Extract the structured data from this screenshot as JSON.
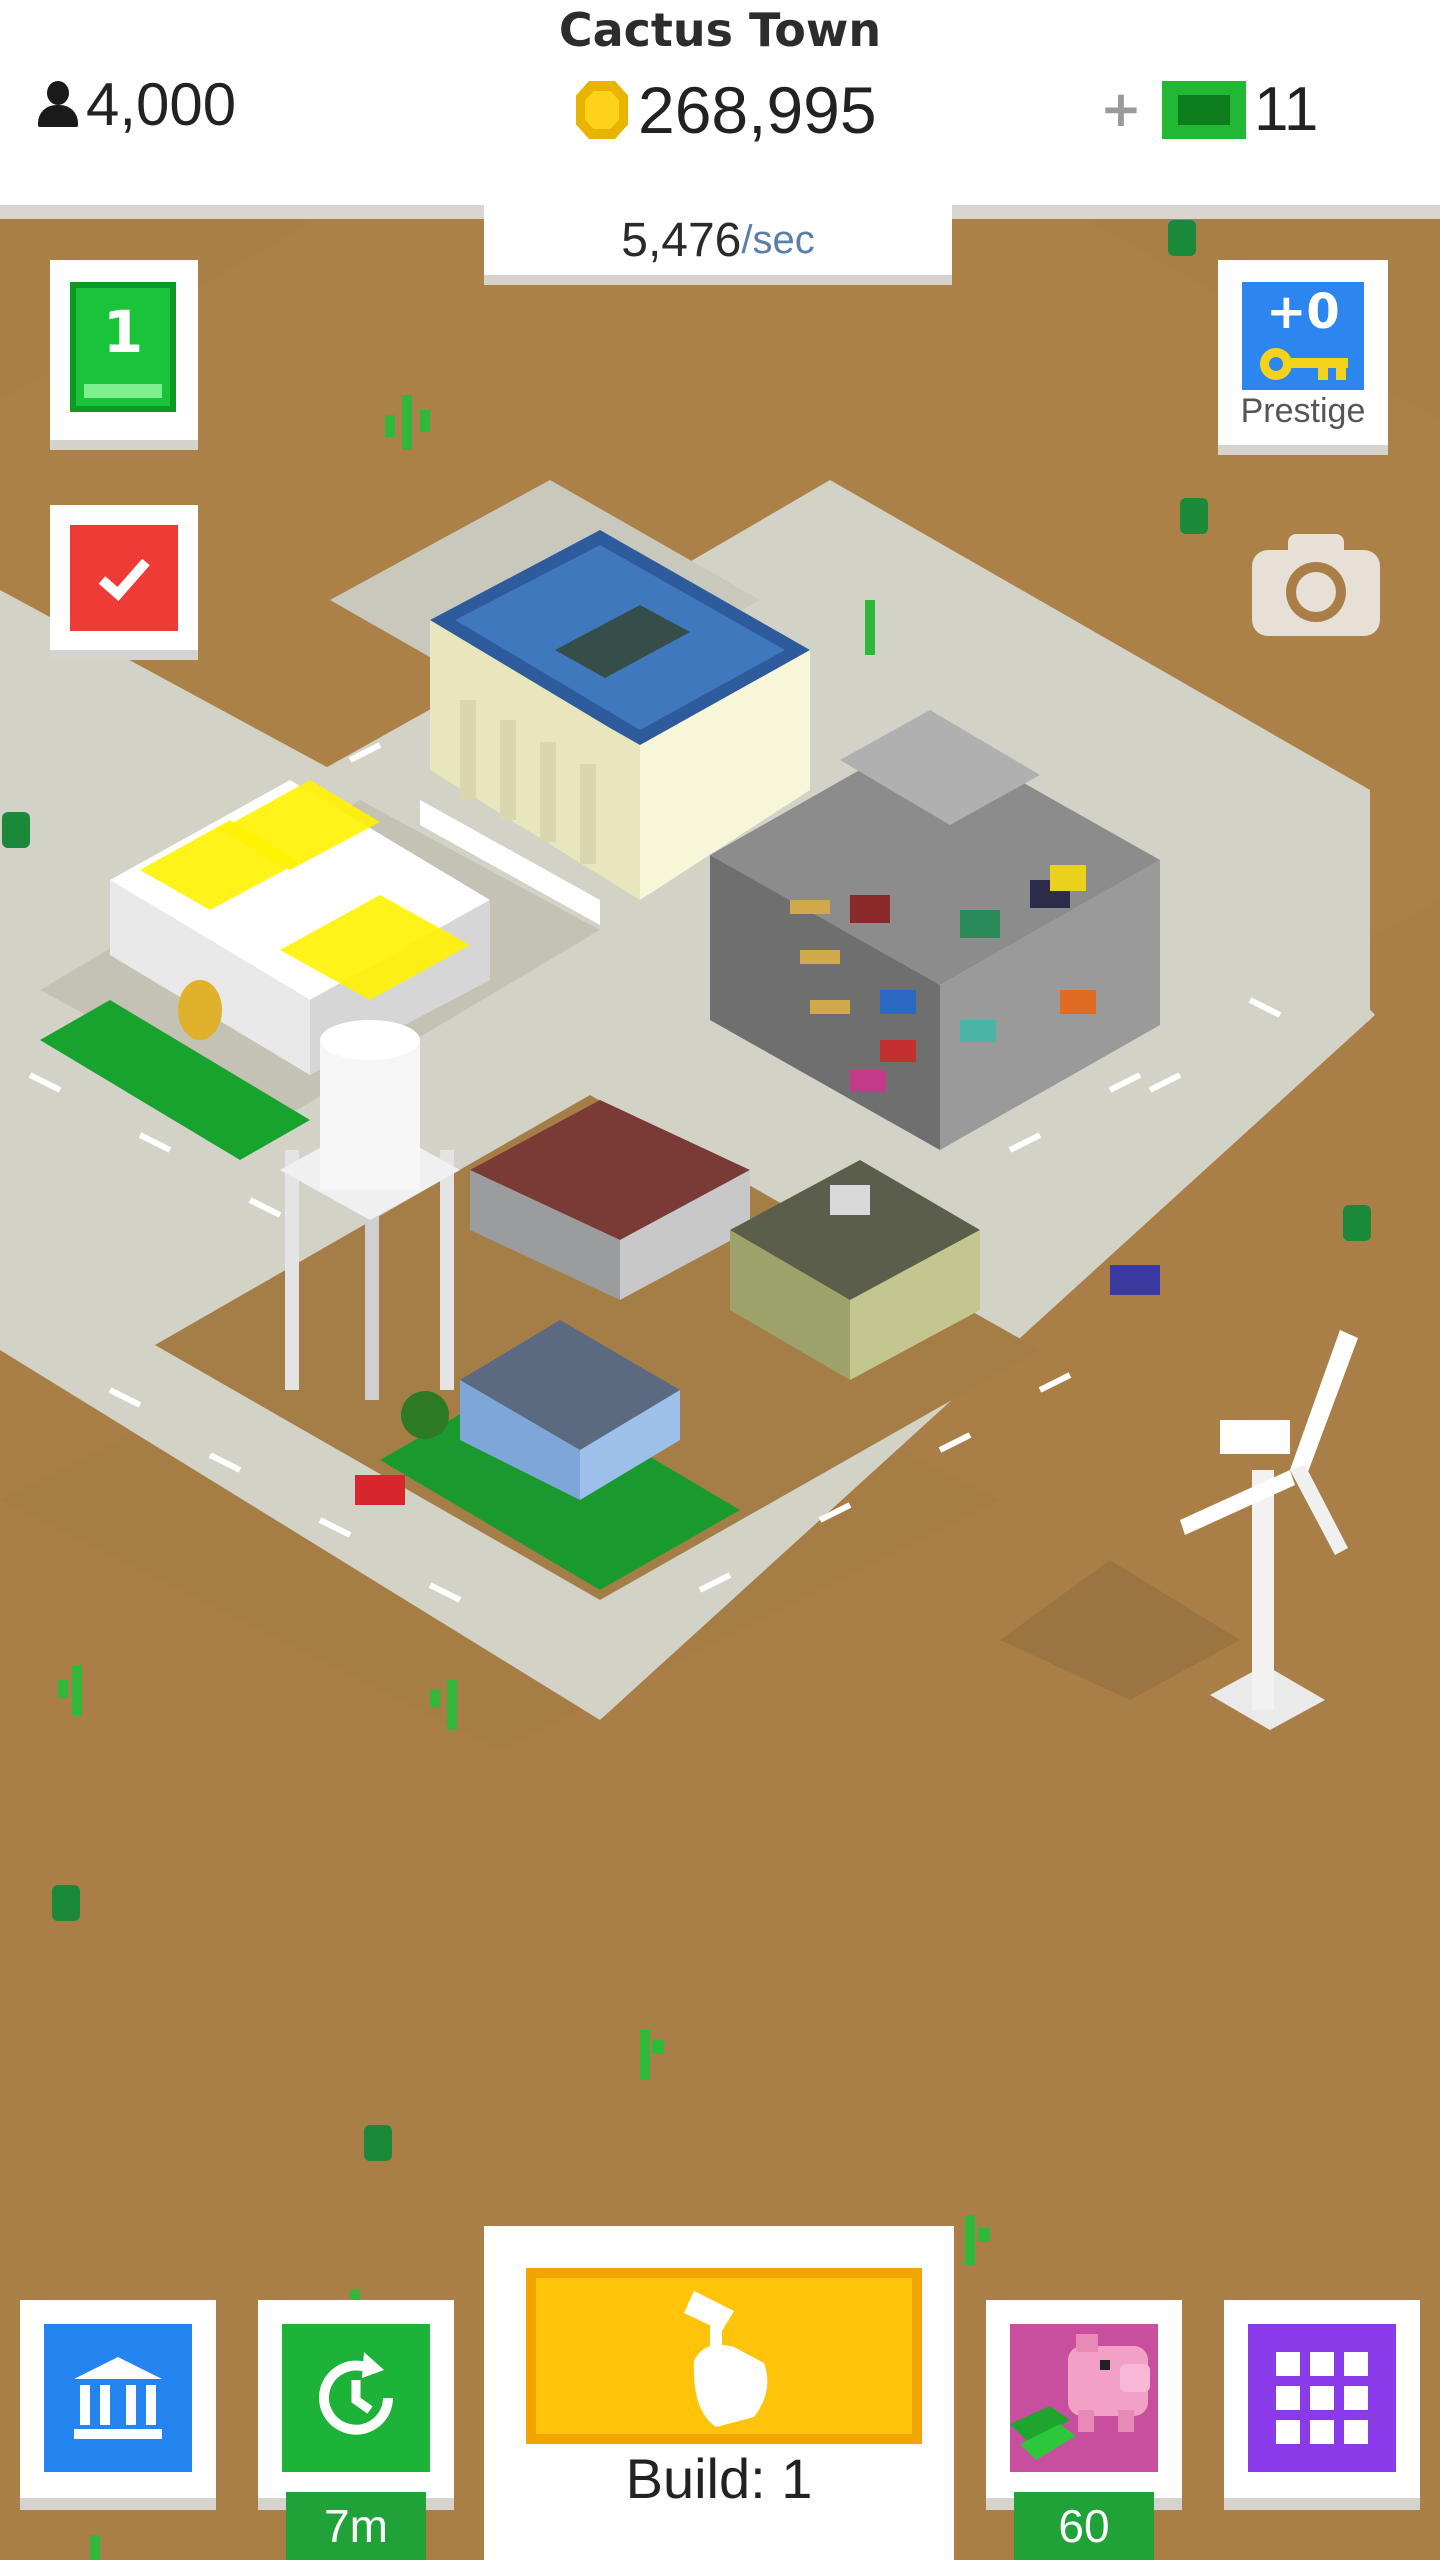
{
  "header": {
    "town_name": "Cactus Town",
    "population": "4,000",
    "coins": "268,995",
    "cash_plus": "+",
    "cash": "11",
    "rate_value": "5,476",
    "rate_unit": "/sec"
  },
  "side": {
    "level": "1",
    "prestige_value": "+0",
    "prestige_label": "Prestige"
  },
  "bottom": {
    "time_badge": "7m",
    "build_label": "Build: 1",
    "piggy_badge": "60"
  },
  "colors": {
    "desert": "#a97f47",
    "road": "#d3d2c6",
    "coin": "#ffd21a",
    "cash": "#22b833",
    "build": "#ffc40a"
  },
  "icons": [
    "person-icon",
    "coin-icon",
    "cash-icon",
    "checkmark-icon",
    "key-icon",
    "camera-icon",
    "bank-icon",
    "clock-icon",
    "build-hand-icon",
    "piggy-bank-icon",
    "grid-icon"
  ]
}
